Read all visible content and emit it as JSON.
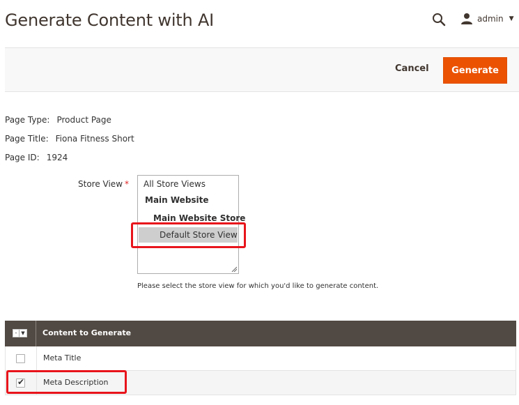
{
  "header": {
    "title": "Generate Content with AI",
    "user": "admin"
  },
  "actions": {
    "cancel_label": "Cancel",
    "generate_label": "Generate"
  },
  "info": {
    "page_type_label": "Page Type:",
    "page_type_value": "Product Page",
    "page_title_label": "Page Title:",
    "page_title_value": "Fiona Fitness Short",
    "page_id_label": "Page ID:",
    "page_id_value": "1924"
  },
  "store_view": {
    "label": "Store View",
    "required_mark": "*",
    "options": [
      {
        "label": "All Store Views",
        "selected": false
      },
      {
        "label": "Main Website",
        "selected": false
      },
      {
        "label": "Main Website Store",
        "selected": false
      },
      {
        "label": "Default Store View",
        "selected": true
      }
    ],
    "hint": "Please select the store view for which you'd like to generate content."
  },
  "grid": {
    "column_header": "Content to Generate",
    "rows": [
      {
        "label": "Meta Title",
        "checked": false
      },
      {
        "label": "Meta Description",
        "checked": true
      }
    ]
  },
  "colors": {
    "accent": "#eb5202",
    "grid_header": "#514943",
    "highlight": "#e8141b"
  }
}
